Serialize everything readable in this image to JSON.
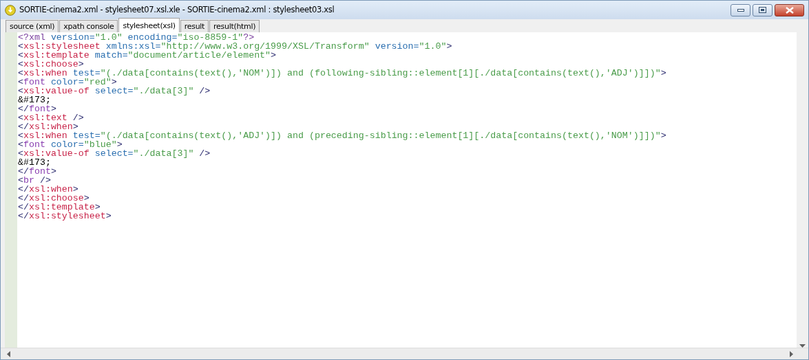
{
  "window": {
    "title": "SORTIE-cinema2.xml - stylesheet07.xsl.xle - SORTIE-cinema2.xml : stylesheet03.xsl"
  },
  "tabs": [
    {
      "label": "source (xml)",
      "selected": false
    },
    {
      "label": "xpath console",
      "selected": false
    },
    {
      "label": "stylesheet(xsl)",
      "selected": true
    },
    {
      "label": "result",
      "selected": false
    },
    {
      "label": "result(html)",
      "selected": false
    }
  ],
  "editor": {
    "lines": [
      [
        {
          "kind": "decl",
          "text": "<?xml"
        },
        {
          "kind": "attr",
          "text": " version="
        },
        {
          "kind": "value",
          "text": "\"1.0\""
        },
        {
          "kind": "attr",
          "text": " encoding="
        },
        {
          "kind": "value",
          "text": "\"iso-8859-1\""
        },
        {
          "kind": "decl",
          "text": "?>"
        }
      ],
      [
        {
          "kind": "punct",
          "text": "<"
        },
        {
          "kind": "xsl",
          "text": "xsl:stylesheet"
        },
        {
          "kind": "attr",
          "text": " xmlns:xsl="
        },
        {
          "kind": "value",
          "text": "\"http://www.w3.org/1999/XSL/Transform\""
        },
        {
          "kind": "attr",
          "text": " version="
        },
        {
          "kind": "value",
          "text": "\"1.0\""
        },
        {
          "kind": "punct",
          "text": ">"
        }
      ],
      [
        {
          "kind": "punct",
          "text": "<"
        },
        {
          "kind": "xsl",
          "text": "xsl:template"
        },
        {
          "kind": "attr",
          "text": " match="
        },
        {
          "kind": "value",
          "text": "\"document/article/element\""
        },
        {
          "kind": "punct",
          "text": ">"
        }
      ],
      [
        {
          "kind": "punct",
          "text": "<"
        },
        {
          "kind": "xsl",
          "text": "xsl:choose"
        },
        {
          "kind": "punct",
          "text": ">"
        }
      ],
      [
        {
          "kind": "punct",
          "text": "<"
        },
        {
          "kind": "xsl",
          "text": "xsl:when"
        },
        {
          "kind": "attr",
          "text": " test="
        },
        {
          "kind": "value",
          "text": "\"(./data[contains(text(),'NOM')]) and (following-sibling::element[1][./data[contains(text(),'ADJ')]])\""
        },
        {
          "kind": "punct",
          "text": ">"
        }
      ],
      [
        {
          "kind": "punct",
          "text": "<"
        },
        {
          "kind": "html",
          "text": "font"
        },
        {
          "kind": "attr",
          "text": " color="
        },
        {
          "kind": "value",
          "text": "\"red\""
        },
        {
          "kind": "punct",
          "text": ">"
        }
      ],
      [
        {
          "kind": "punct",
          "text": "<"
        },
        {
          "kind": "xsl",
          "text": "xsl:value-of"
        },
        {
          "kind": "attr",
          "text": " select="
        },
        {
          "kind": "value",
          "text": "\"./data[3]\""
        },
        {
          "kind": "punct",
          "text": " />"
        }
      ],
      [
        {
          "kind": "text",
          "text": "&#173;"
        }
      ],
      [
        {
          "kind": "punct",
          "text": "</"
        },
        {
          "kind": "html",
          "text": "font"
        },
        {
          "kind": "punct",
          "text": ">"
        }
      ],
      [
        {
          "kind": "punct",
          "text": "<"
        },
        {
          "kind": "xsl",
          "text": "xsl:text"
        },
        {
          "kind": "punct",
          "text": " />"
        }
      ],
      [
        {
          "kind": "punct",
          "text": "</"
        },
        {
          "kind": "xsl",
          "text": "xsl:when"
        },
        {
          "kind": "punct",
          "text": ">"
        }
      ],
      [
        {
          "kind": "punct",
          "text": "<"
        },
        {
          "kind": "xsl",
          "text": "xsl:when"
        },
        {
          "kind": "attr",
          "text": " test="
        },
        {
          "kind": "value",
          "text": "\"(./data[contains(text(),'ADJ')]) and (preceding-sibling::element[1][./data[contains(text(),'NOM')]])\""
        },
        {
          "kind": "punct",
          "text": ">"
        }
      ],
      [
        {
          "kind": "punct",
          "text": "<"
        },
        {
          "kind": "html",
          "text": "font"
        },
        {
          "kind": "attr",
          "text": " color="
        },
        {
          "kind": "value",
          "text": "\"blue\""
        },
        {
          "kind": "punct",
          "text": ">"
        }
      ],
      [
        {
          "kind": "punct",
          "text": "<"
        },
        {
          "kind": "xsl",
          "text": "xsl:value-of"
        },
        {
          "kind": "attr",
          "text": " select="
        },
        {
          "kind": "value",
          "text": "\"./data[3]\""
        },
        {
          "kind": "punct",
          "text": " />"
        }
      ],
      [
        {
          "kind": "text",
          "text": "&#173;"
        }
      ],
      [
        {
          "kind": "punct",
          "text": "</"
        },
        {
          "kind": "html",
          "text": "font"
        },
        {
          "kind": "punct",
          "text": ">"
        }
      ],
      [
        {
          "kind": "punct",
          "text": "<"
        },
        {
          "kind": "html",
          "text": "br"
        },
        {
          "kind": "punct",
          "text": " />"
        }
      ],
      [
        {
          "kind": "punct",
          "text": "</"
        },
        {
          "kind": "xsl",
          "text": "xsl:when"
        },
        {
          "kind": "punct",
          "text": ">"
        }
      ],
      [
        {
          "kind": "punct",
          "text": "</"
        },
        {
          "kind": "xsl",
          "text": "xsl:choose"
        },
        {
          "kind": "punct",
          "text": ">"
        }
      ],
      [
        {
          "kind": "punct",
          "text": "</"
        },
        {
          "kind": "xsl",
          "text": "xsl:template"
        },
        {
          "kind": "punct",
          "text": ">"
        }
      ],
      [
        {
          "kind": "punct",
          "text": "</"
        },
        {
          "kind": "xsl",
          "text": "xsl:stylesheet"
        },
        {
          "kind": "punct",
          "text": ">"
        }
      ]
    ]
  }
}
